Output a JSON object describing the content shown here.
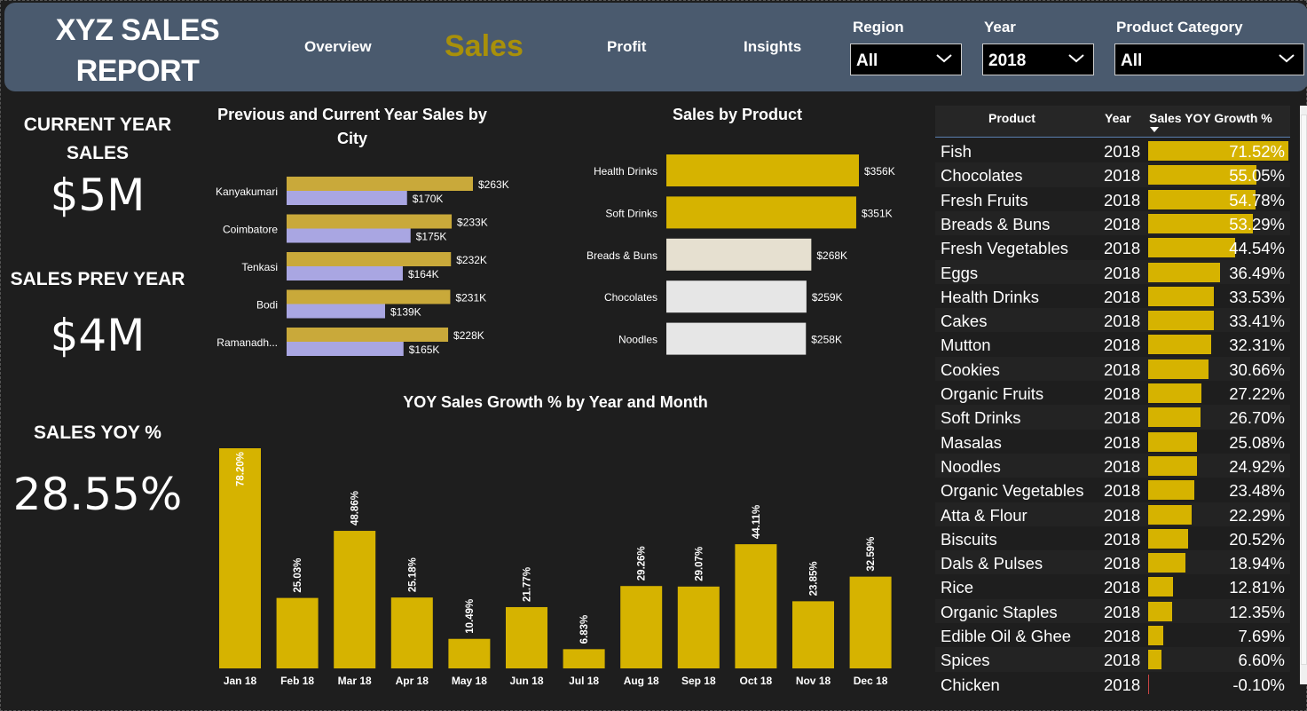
{
  "header": {
    "title_line1": "XYZ SALES",
    "title_line2": "REPORT",
    "nav": [
      "Overview",
      "Sales",
      "Profit",
      "Insights"
    ],
    "active_nav": "Sales",
    "filters": [
      {
        "label": "Region",
        "value": "All"
      },
      {
        "label": "Year",
        "value": "2018"
      },
      {
        "label": "Product Category",
        "value": "All"
      }
    ]
  },
  "kpis": {
    "current_year_label_line1": "CURRENT YEAR",
    "current_year_label_line2": "SALES",
    "current_year_value": "$5M",
    "prev_year_label": "SALES PREV YEAR",
    "prev_year_value": "$4M",
    "yoy_label": "SALES YOY %",
    "yoy_value": "28.55%"
  },
  "colors": {
    "gold": "#d6b300",
    "gold_muted": "#c9a93a",
    "lavender": "#a9a6e2",
    "cream": "#e6e0d0",
    "light_gray": "#e6e6e6"
  },
  "chart_data": [
    {
      "type": "bar",
      "orientation": "horizontal",
      "title_line1": "Previous and Current Year Sales by",
      "title_line2": "City",
      "categories": [
        "Kanyakumari",
        "Coimbatore",
        "Tenkasi",
        "Bodi",
        "Ramanadh..."
      ],
      "series": [
        {
          "values": [
            263,
            233,
            232,
            231,
            228
          ],
          "labels": [
            "$263K",
            "$233K",
            "$232K",
            "$231K",
            "$228K"
          ]
        },
        {
          "values": [
            170,
            175,
            164,
            139,
            165
          ],
          "labels": [
            "$170K",
            "$175K",
            "$164K",
            "$139K",
            "$165K"
          ]
        }
      ],
      "units": "K$"
    },
    {
      "type": "bar",
      "orientation": "horizontal",
      "title": "Sales by Product",
      "categories": [
        "Health Drinks",
        "Soft Drinks",
        "Breads & Buns",
        "Chocolates",
        "Noodles"
      ],
      "values": [
        356,
        351,
        268,
        259,
        258
      ],
      "labels": [
        "$356K",
        "$351K",
        "$268K",
        "$259K",
        "$258K"
      ]
    },
    {
      "type": "bar",
      "title": "YOY Sales Growth % by Year and Month",
      "categories": [
        "Jan 18",
        "Feb 18",
        "Mar 18",
        "Apr 18",
        "May 18",
        "Jun 18",
        "Jul 18",
        "Aug 18",
        "Sep 18",
        "Oct 18",
        "Nov 18",
        "Dec 18"
      ],
      "values": [
        78.2,
        25.03,
        48.86,
        25.18,
        10.49,
        21.77,
        6.83,
        29.26,
        29.07,
        44.11,
        23.85,
        32.59
      ],
      "labels": [
        "78.20%",
        "25.03%",
        "48.86%",
        "25.18%",
        "10.49%",
        "21.77%",
        "6.83%",
        "29.26%",
        "29.07%",
        "44.11%",
        "23.85%",
        "32.59%"
      ]
    },
    {
      "type": "table",
      "columns": [
        "Product",
        "Year",
        "Sales YOY Growth %"
      ],
      "rows": [
        {
          "product": "Fish",
          "year": "2018",
          "growth": 71.52,
          "label": "71.52%"
        },
        {
          "product": "Chocolates",
          "year": "2018",
          "growth": 55.05,
          "label": "55.05%"
        },
        {
          "product": "Fresh Fruits",
          "year": "2018",
          "growth": 54.78,
          "label": "54.78%"
        },
        {
          "product": "Breads & Buns",
          "year": "2018",
          "growth": 53.29,
          "label": "53.29%"
        },
        {
          "product": "Fresh Vegetables",
          "year": "2018",
          "growth": 44.54,
          "label": "44.54%"
        },
        {
          "product": "Eggs",
          "year": "2018",
          "growth": 36.49,
          "label": "36.49%"
        },
        {
          "product": "Health Drinks",
          "year": "2018",
          "growth": 33.53,
          "label": "33.53%"
        },
        {
          "product": "Cakes",
          "year": "2018",
          "growth": 33.41,
          "label": "33.41%"
        },
        {
          "product": "Mutton",
          "year": "2018",
          "growth": 32.31,
          "label": "32.31%"
        },
        {
          "product": "Cookies",
          "year": "2018",
          "growth": 30.66,
          "label": "30.66%"
        },
        {
          "product": "Organic Fruits",
          "year": "2018",
          "growth": 27.22,
          "label": "27.22%"
        },
        {
          "product": "Soft Drinks",
          "year": "2018",
          "growth": 26.7,
          "label": "26.70%"
        },
        {
          "product": "Masalas",
          "year": "2018",
          "growth": 25.08,
          "label": "25.08%"
        },
        {
          "product": "Noodles",
          "year": "2018",
          "growth": 24.92,
          "label": "24.92%"
        },
        {
          "product": "Organic Vegetables",
          "year": "2018",
          "growth": 23.48,
          "label": "23.48%"
        },
        {
          "product": "Atta & Flour",
          "year": "2018",
          "growth": 22.29,
          "label": "22.29%"
        },
        {
          "product": "Biscuits",
          "year": "2018",
          "growth": 20.52,
          "label": "20.52%"
        },
        {
          "product": "Dals & Pulses",
          "year": "2018",
          "growth": 18.94,
          "label": "18.94%"
        },
        {
          "product": "Rice",
          "year": "2018",
          "growth": 12.81,
          "label": "12.81%"
        },
        {
          "product": "Organic Staples",
          "year": "2018",
          "growth": 12.35,
          "label": "12.35%"
        },
        {
          "product": "Edible Oil & Ghee",
          "year": "2018",
          "growth": 7.69,
          "label": "7.69%"
        },
        {
          "product": "Spices",
          "year": "2018",
          "growth": 6.6,
          "label": "6.60%"
        },
        {
          "product": "Chicken",
          "year": "2018",
          "growth": -0.1,
          "label": "-0.10%"
        }
      ]
    }
  ]
}
